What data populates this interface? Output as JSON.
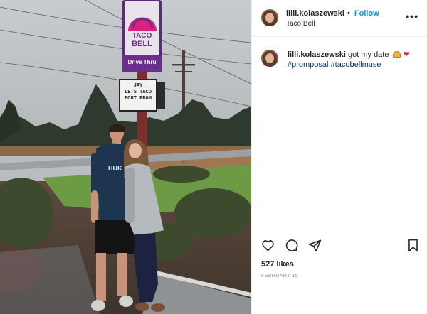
{
  "post": {
    "username": "lilli.kolaszewski",
    "separator": "•",
    "follow_label": "Follow",
    "location": "Taco Bell",
    "more_label": "•••",
    "caption_text": "got my date",
    "hashtags": [
      "#promposal",
      "#tacobellmuse"
    ],
    "likes": "527 likes",
    "date": "FEBRUARY 16"
  },
  "photo": {
    "sign_brand_line1": "TACO",
    "sign_brand_line2": "BELL",
    "sign_drive_thru": "Drive Thru",
    "marquee_line1": "JAY",
    "marquee_line2": "LETS TACO",
    "marquee_line3": "BOUT PROM",
    "shirt_text": "HUK"
  },
  "icons": {
    "like": "heart-outline-icon",
    "comment": "comment-bubble-icon",
    "share": "paper-plane-icon",
    "save": "bookmark-icon",
    "more": "more-options-icon"
  },
  "colors": {
    "follow": "#0095f6",
    "hashtag": "#00376b",
    "taco_bell_purple": "#6b2c8f",
    "taco_bell_pink": "#d9237a"
  }
}
